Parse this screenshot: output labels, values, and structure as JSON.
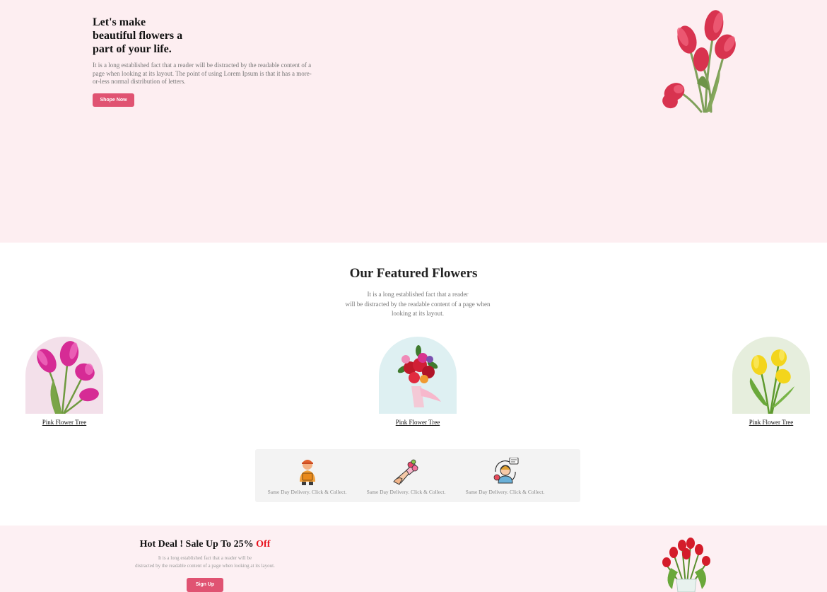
{
  "hero": {
    "title_lines": [
      "Let's make",
      "beautiful flowers a",
      "part of your life."
    ],
    "text": "It is a long established fact that a reader will be distracted by the readable content of a page when looking at its layout. The point of using Lorem Ipsum is that it has a more-or-less normal distribution of letters.",
    "button": "Shope Now",
    "image_icon": "red-tulips-image"
  },
  "featured": {
    "title": "Our Featured Flowers",
    "text_lines": [
      "It is a long established fact that a reader",
      "will be distracted by the readable content of a page when",
      "looking at its layout."
    ],
    "cards": [
      {
        "label": "Pink Flower Tree",
        "bg": "#f3e0ea",
        "icon": "pink-tulips-image"
      },
      {
        "label": "Pink Flower Tree",
        "bg": "#def0f2",
        "icon": "bouquet-image"
      },
      {
        "label": "Pink Flower Tree",
        "bg": "#e6eedd",
        "icon": "yellow-tulips-image"
      }
    ]
  },
  "features": [
    {
      "text": "Same Day Delivery. Click & Collect.",
      "icon": "delivery-man-icon"
    },
    {
      "text": "Same Day Delivery. Click & Collect.",
      "icon": "bouquet-hand-icon"
    },
    {
      "text": "Same Day Delivery. Click & Collect.",
      "icon": "customer-support-icon"
    }
  ],
  "deal": {
    "title": "Hot Deal ! Sale Up To 25%",
    "title_accent": "Off",
    "text_lines": [
      "It is a long established fact that a reader will be",
      "distracted by the readable content of a page when looking at its layout."
    ],
    "button": "Sign Up",
    "image_icon": "red-tulips-vase-image"
  },
  "colors": {
    "accent": "#e05372",
    "hero_bg": "#fdeef1",
    "deal_bg": "#fdf0f3",
    "off_red": "#e8111c"
  }
}
